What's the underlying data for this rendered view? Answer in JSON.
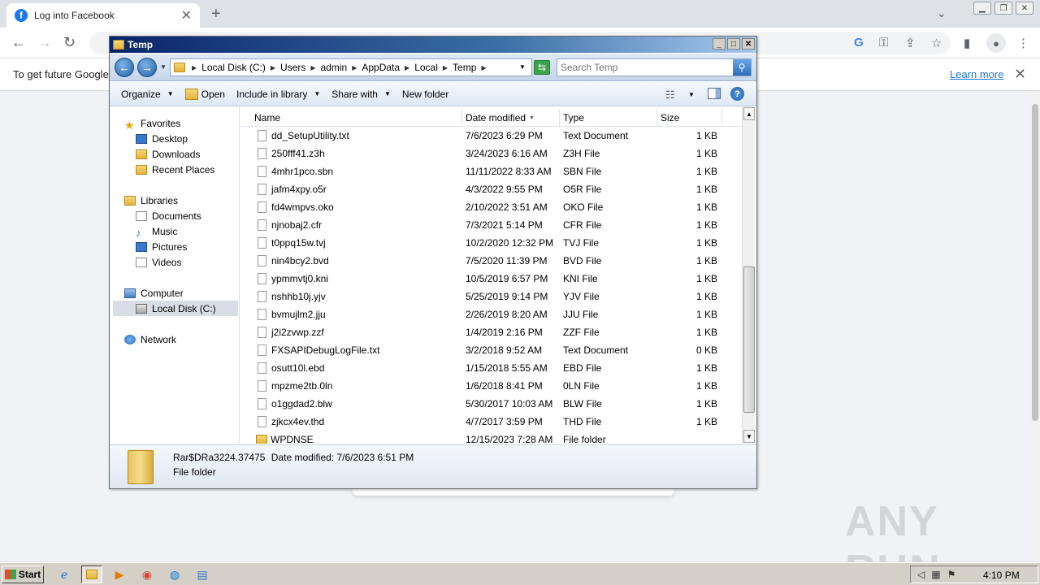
{
  "browser": {
    "tab_title": "Log into Facebook",
    "tab_close": "✕",
    "new_tab": "+",
    "infobar_text": "To get future Google",
    "learn_more": "Learn more",
    "infobar_close": "✕"
  },
  "explorer": {
    "title": "Temp",
    "breadcrumbs": [
      "Local Disk (C:)",
      "Users",
      "admin",
      "AppData",
      "Local",
      "Temp"
    ],
    "search_placeholder": "Search Temp",
    "toolbar": {
      "organize": "Organize",
      "open": "Open",
      "include_in_library": "Include in library",
      "share_with": "Share with",
      "new_folder": "New folder"
    },
    "nav": {
      "favorites": "Favorites",
      "desktop": "Desktop",
      "downloads": "Downloads",
      "recent_places": "Recent Places",
      "libraries": "Libraries",
      "documents": "Documents",
      "music": "Music",
      "pictures": "Pictures",
      "videos": "Videos",
      "computer": "Computer",
      "local_disk": "Local Disk (C:)",
      "network": "Network"
    },
    "columns": {
      "name": "Name",
      "date_modified": "Date modified",
      "type": "Type",
      "size": "Size"
    },
    "files": [
      {
        "name": "dd_SetupUtility.txt",
        "date": "7/6/2023 6:29 PM",
        "type": "Text Document",
        "size": "1 KB"
      },
      {
        "name": "250fff41.z3h",
        "date": "3/24/2023 6:16 AM",
        "type": "Z3H File",
        "size": "1 KB"
      },
      {
        "name": "4mhr1pco.sbn",
        "date": "11/11/2022 8:33 AM",
        "type": "SBN File",
        "size": "1 KB"
      },
      {
        "name": "jafm4xpy.o5r",
        "date": "4/3/2022 9:55 PM",
        "type": "O5R File",
        "size": "1 KB"
      },
      {
        "name": "fd4wmpvs.oko",
        "date": "2/10/2022 3:51 AM",
        "type": "OKO File",
        "size": "1 KB"
      },
      {
        "name": "njnobaj2.cfr",
        "date": "7/3/2021 5:14 PM",
        "type": "CFR File",
        "size": "1 KB"
      },
      {
        "name": "t0ppq15w.tvj",
        "date": "10/2/2020 12:32 PM",
        "type": "TVJ File",
        "size": "1 KB"
      },
      {
        "name": "nin4bcy2.bvd",
        "date": "7/5/2020 11:39 PM",
        "type": "BVD File",
        "size": "1 KB"
      },
      {
        "name": "ypmmvtj0.kni",
        "date": "10/5/2019 6:57 PM",
        "type": "KNI File",
        "size": "1 KB"
      },
      {
        "name": "nshhb10j.yjv",
        "date": "5/25/2019 9:14 PM",
        "type": "YJV File",
        "size": "1 KB"
      },
      {
        "name": "bvmujlm2.jju",
        "date": "2/26/2019 8:20 AM",
        "type": "JJU File",
        "size": "1 KB"
      },
      {
        "name": "j2i2zvwp.zzf",
        "date": "1/4/2019 2:16 PM",
        "type": "ZZF File",
        "size": "1 KB"
      },
      {
        "name": "FXSAPIDebugLogFile.txt",
        "date": "3/2/2018 9:52 AM",
        "type": "Text Document",
        "size": "0 KB"
      },
      {
        "name": "osutt10l.ebd",
        "date": "1/15/2018 5:55 AM",
        "type": "EBD File",
        "size": "1 KB"
      },
      {
        "name": "mpzme2tb.0ln",
        "date": "1/6/2018 8:41 PM",
        "type": "0LN File",
        "size": "1 KB"
      },
      {
        "name": "o1ggdad2.blw",
        "date": "5/30/2017 10:03 AM",
        "type": "BLW File",
        "size": "1 KB"
      },
      {
        "name": "zjkcx4ev.thd",
        "date": "4/7/2017 3:59 PM",
        "type": "THD File",
        "size": "1 KB"
      },
      {
        "name": "WPDNSE",
        "date": "12/15/2023 7:28 AM",
        "type": "File folder",
        "size": ""
      }
    ],
    "details": {
      "name": "Rar$DRa3224.37475",
      "date_label": "Date modified:",
      "date": "7/6/2023 6:51 PM",
      "type": "File folder"
    }
  },
  "taskbar": {
    "start": "Start",
    "clock": "4:10 PM"
  },
  "watermark": "ANY RUN"
}
